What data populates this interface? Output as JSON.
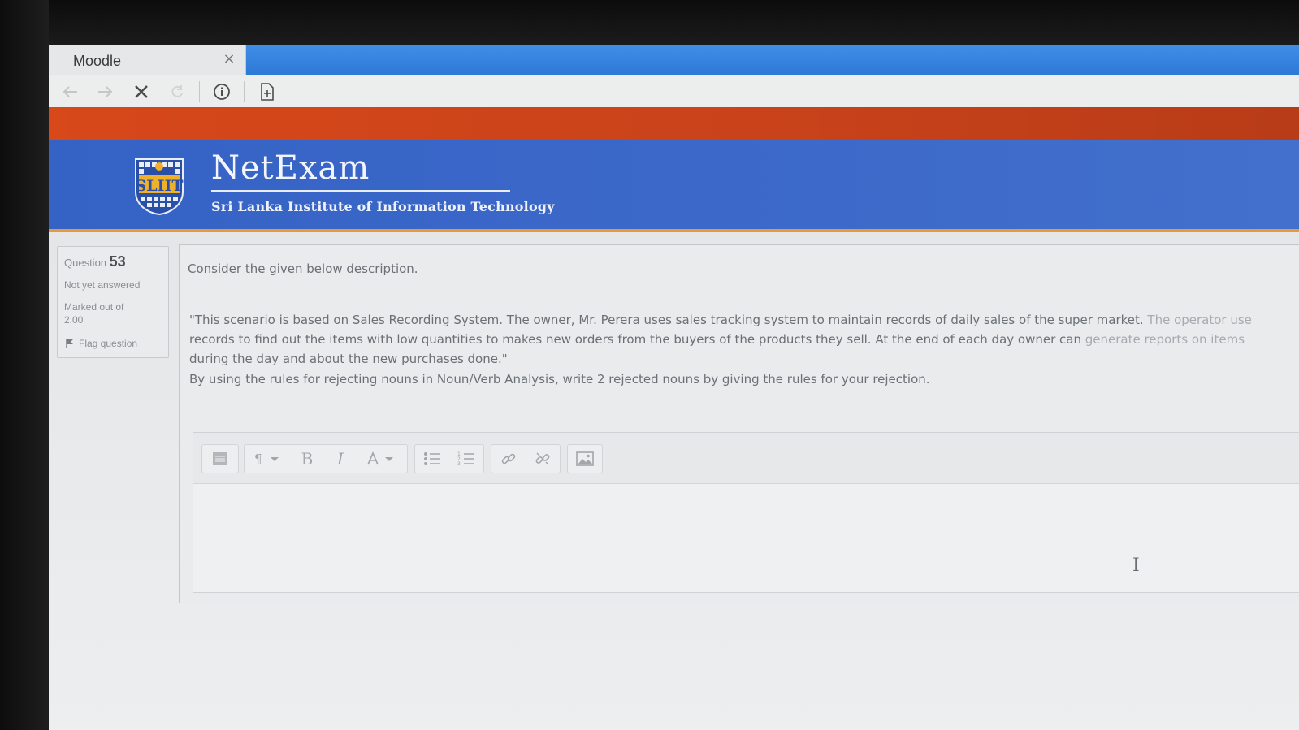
{
  "browser": {
    "tab_title": "Moodle",
    "tab_close": "×"
  },
  "site": {
    "brand_title": "NetExam",
    "brand_subtitle": "Sri Lanka Institute of Information Technology",
    "logo_text": "SLIIT",
    "accent_orange": "#d7481a",
    "accent_blue": "#3563c5"
  },
  "question_info": {
    "label": "Question",
    "number": "53",
    "state": "Not yet answered",
    "marked": "Marked out of",
    "max_mark": "2.00",
    "flag": "Flag question"
  },
  "question": {
    "intro": "Consider the given below description.",
    "scenario_line1": "\"This scenario is based on Sales Recording System.  The owner, Mr. Perera uses sales tracking system to maintain records of daily sales of the super market.",
    "scenario_line1_faded": " The operator use",
    "scenario_line2": "records to find out the items with low quantities to makes new orders from the buyers of the products they sell. At the end of each day owner can",
    "scenario_line2_faded": " generate reports on items",
    "scenario_line3": "during the day and about the new purchases done.\"",
    "task": "By using the rules for rejecting nouns in Noun/Verb Analysis, write 2 rejected nouns by giving the rules for your rejection."
  },
  "editor_toolbar": {
    "bold": "B",
    "italic": "I",
    "cursor_glyph": "I"
  }
}
